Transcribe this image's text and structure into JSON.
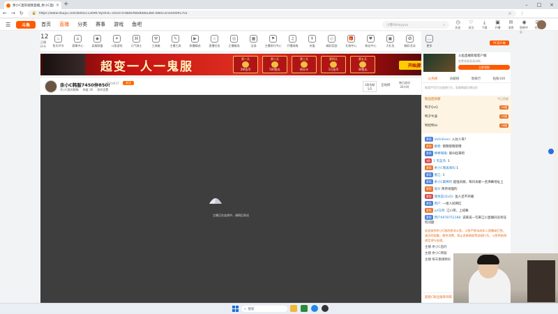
{
  "browser": {
    "tab_title": "余小C直的视频直播_余小C直的...",
    "url": "https://www.douyu.com/beta/112690?dyshid=165d7d-bb85f6bd66ba3847bb053c5e00091701"
  },
  "site": {
    "logo_text": "斗鱼",
    "nav": [
      "首页",
      "直播",
      "分类",
      "赛事",
      "游戏",
      "鱼吧"
    ],
    "search_placeholder": "小鲁fithieyyou",
    "header_icons": [
      "历史",
      "关注",
      "下载",
      "开播",
      "消息",
      "鱼吧中心",
      "任务"
    ]
  },
  "categories": {
    "first": {
      "count": "12",
      "label": "正播环节"
    },
    "items": [
      "鱼乐环节",
      "赛事中心",
      "英雄联盟",
      "斗鱼游戏",
      "元气骑士",
      "工具箱",
      "主播工具",
      "热播精选",
      "直播任务",
      "正播精选",
      "全部",
      "主播排行中心",
      "开播攻略",
      "充值",
      "精彩奖励",
      "礼物中心",
      "粉丝中心",
      "大礼包",
      "精彩活动",
      "更多"
    ]
  },
  "banner": {
    "headline": "超变一人一鬼服",
    "prizes": [
      {
        "day": "第一天",
        "reward": "2W金币"
      },
      {
        "day": "第二天",
        "reward": "500鱼丸"
      },
      {
        "day": "第三天",
        "reward": "积分卡"
      },
      {
        "day": "第四天",
        "reward": "1万金币"
      },
      {
        "day": "第五天",
        "reward": "30鱼丸"
      }
    ],
    "cta": "开始游戏"
  },
  "room": {
    "title": "余小C韩服7450仲850!",
    "views": "8164437",
    "follow": "关注",
    "sub": [
      "余小C直的眼睛",
      "热度 2K",
      "房间设置"
    ],
    "rank_label": "1周贡献",
    "rank_value": "1/5",
    "allrank": "全站榜",
    "daily_label": "每日战况",
    "daily_value": "20小时"
  },
  "player": {
    "status": "主播正在连线中，请稍后再试"
  },
  "right": {
    "pc_button": "PC用户端",
    "ad_title": "斗鱼直播新版客户端",
    "ad_sub": "免费观看高清流畅",
    "ad_button": "立即领取",
    "tabs": [
      "火热榜",
      "贡献榜",
      "周排行",
      "钻粉100"
    ],
    "notice": "各类严厉打击违规行为，恶意刷屏后果自负",
    "fan_header": "粉丝团贡献",
    "fan_sub": "今日贡献",
    "fans": [
      {
        "name": "鸭子QvQ",
        "level": "24级"
      },
      {
        "name": "鸭子牛逼",
        "level": "20级"
      },
      {
        "name": "鸭哈鸭kk",
        "level": "18级"
      }
    ],
    "messages": [
      {
        "badge": "萝莉",
        "name": "Ve0n0ven:",
        "text": "入驻人哥?"
      },
      {
        "badge": "萝莉",
        "name": "橱柜:",
        "text": "嗯嗯嗯嗯嗯哦"
      },
      {
        "badge": "萝莉",
        "name": "棒棒嗡嗡:",
        "text": "观众起来吧"
      },
      {
        "badge": "3阶",
        "name": "1 笑蓝鸟:",
        "text": "1"
      },
      {
        "badge": "萝莉",
        "name": "余小C我再来叫",
        "text": "1"
      },
      {
        "badge": "萝莉",
        "name": "图江:",
        "text": "1"
      },
      {
        "badge": "萝莉",
        "name": "余小C最棒的",
        "text": "超强贡献，每日贡献一名弹幕地址上"
      },
      {
        "badge": "萝莉",
        "name": "观众",
        "text": "简单地理的"
      },
      {
        "badge": "萝莉",
        "name": "我余是(QvQ):",
        "text": "鱼人还不开播"
      },
      {
        "badge": "萝莉",
        "name": "用户:",
        "text": "一组人民网红"
      },
      {
        "badge": "萝莉",
        "name": "yd马哥:",
        "text": "江川哥，上班嘛"
      },
      {
        "badge": "萝莉",
        "name": "用户6978752188:",
        "text": "说来说一句来江川直播间没有任何问题"
      }
    ],
    "system_text": "欢迎来到余小C直的房间斗鱼，斗鱼严禁未成年人直播或打赏，请文明观看，理性消费，禁止恶意刷屏等违规行为，斗鱼将依照规定进行处理。",
    "bottom_rows": [
      "主播  余小C直的",
      "主播  余小C韩服",
      "主播  每天重播精彩"
    ],
    "chat_input": "超级C粉丝徽章领取"
  },
  "taskbar": {
    "search": "搜索"
  }
}
